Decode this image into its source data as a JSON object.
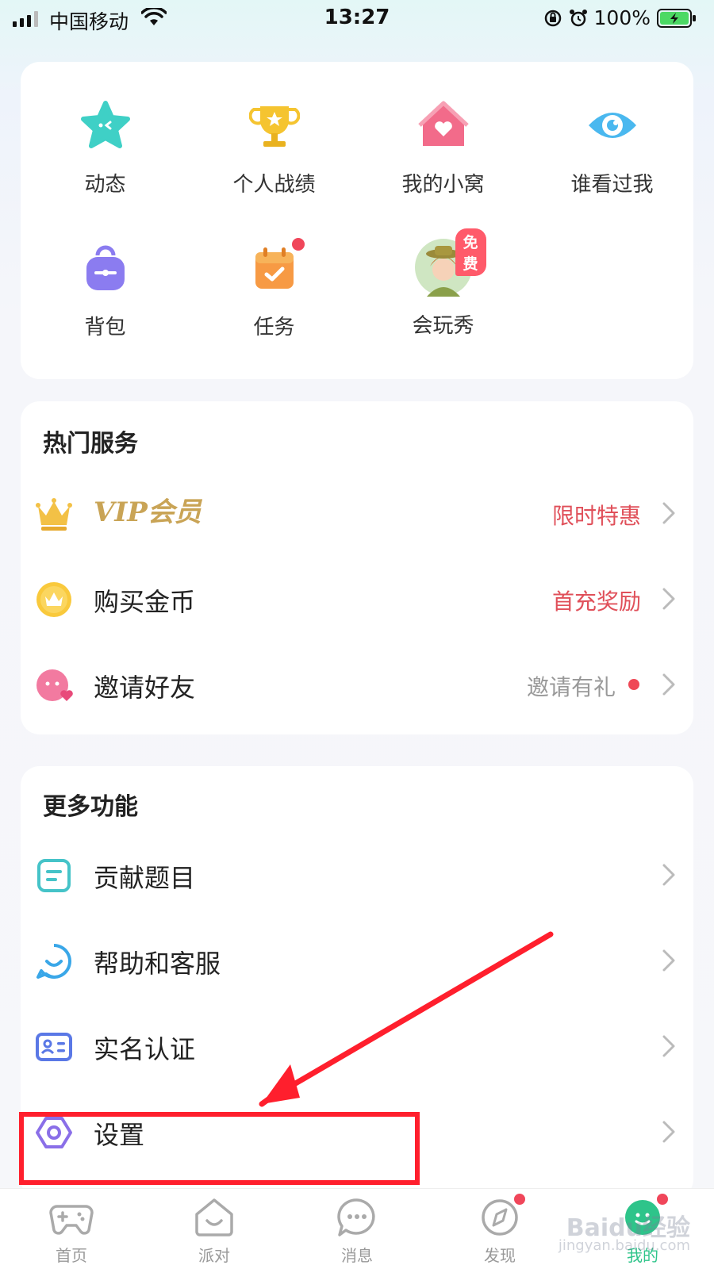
{
  "status_bar": {
    "carrier": "中国移动",
    "time": "13:27",
    "battery": "100%"
  },
  "grid": {
    "items": [
      {
        "label": "动态",
        "icon": "star-icon"
      },
      {
        "label": "个人战绩",
        "icon": "trophy-icon"
      },
      {
        "label": "我的小窝",
        "icon": "house-icon"
      },
      {
        "label": "谁看过我",
        "icon": "eye-icon"
      },
      {
        "label": "背包",
        "icon": "backpack-icon"
      },
      {
        "label": "任务",
        "icon": "calendar-check-icon"
      },
      {
        "label": "会玩秀",
        "icon": "avatar-icon",
        "badge": "免费"
      }
    ]
  },
  "hot_services": {
    "title": "热门服务",
    "items": [
      {
        "label": "VIP会员",
        "tag": "限时特惠",
        "icon": "crown-icon"
      },
      {
        "label": "购买金币",
        "tag": "首充奖励",
        "icon": "coin-icon"
      },
      {
        "label": "邀请好友",
        "tag": "邀请有礼",
        "icon": "invite-icon"
      }
    ]
  },
  "more_features": {
    "title": "更多功能",
    "items": [
      {
        "label": "贡献题目",
        "icon": "document-icon"
      },
      {
        "label": "帮助和客服",
        "icon": "support-icon"
      },
      {
        "label": "实名认证",
        "icon": "id-card-icon"
      },
      {
        "label": "设置",
        "icon": "settings-hexagon-icon"
      }
    ]
  },
  "tabbar": {
    "tabs": [
      {
        "label": "首页",
        "icon": "gamepad-icon"
      },
      {
        "label": "派对",
        "icon": "party-icon"
      },
      {
        "label": "消息",
        "icon": "chat-icon"
      },
      {
        "label": "发现",
        "icon": "compass-icon"
      },
      {
        "label": "我的",
        "icon": "profile-icon",
        "active": true
      }
    ]
  },
  "watermark": {
    "brand": "Baidu经验",
    "url": "jingyan.baidu.com"
  },
  "colors": {
    "accent_green": "#2ec48a",
    "tag_red": "#e0505a",
    "annotation_red": "#ff1f2d",
    "vip_gold": "#c9a456"
  }
}
